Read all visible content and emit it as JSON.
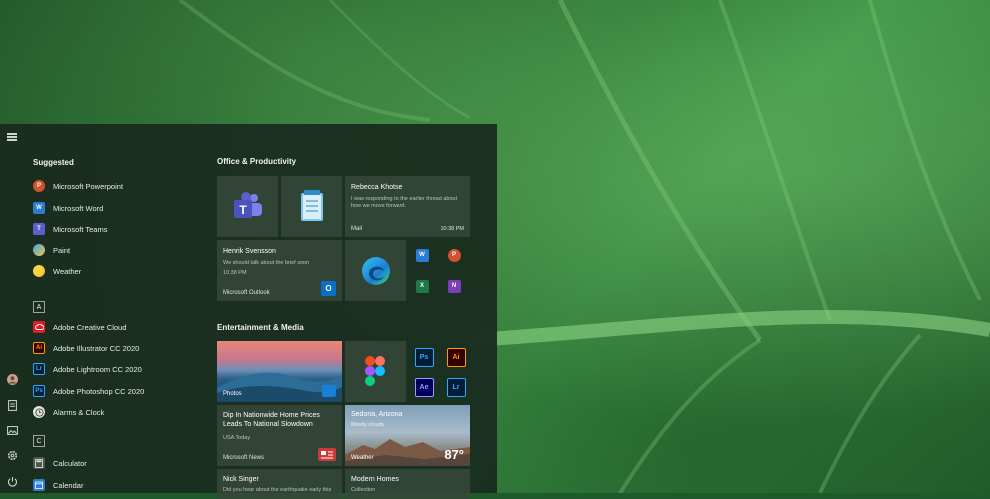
{
  "colors": {
    "accent_teams": "#5b5fc7",
    "accent_word": "#2b7cd3",
    "accent_excel": "#1e7a45",
    "accent_powerpoint": "#d35230",
    "accent_onenote": "#7b3fb5",
    "accent_outlook": "#0a6fc8",
    "accent_news": "#c93a3a",
    "photoshop_blue": "#31a8ff",
    "illustrator_orange": "#ff9a00",
    "aftereffects_purple": "#9999ff",
    "lightroom_blue": "#31a8ff"
  },
  "rail_icons": [
    "hamburger-icon",
    "user-avatar-icon",
    "document-icon",
    "pictures-icon",
    "settings-icon",
    "power-icon"
  ],
  "suggested": {
    "title": "Suggested",
    "items": [
      {
        "label": "Microsoft Powerpoint",
        "icon": "powerpoint-icon"
      },
      {
        "label": "Microsoft Word",
        "icon": "word-icon"
      },
      {
        "label": "Microsoft Teams",
        "icon": "teams-icon"
      },
      {
        "label": "Paint",
        "icon": "paint-icon"
      },
      {
        "label": "Weather",
        "icon": "weather-icon"
      }
    ]
  },
  "section_a": {
    "letter": "A",
    "items": [
      {
        "label": "Adobe Creative Cloud",
        "icon": "creative-cloud-icon"
      },
      {
        "label": "Adobe Illustrator CC 2020",
        "icon": "illustrator-icon",
        "abbr": "Ai"
      },
      {
        "label": "Adobe Lightroom CC 2020",
        "icon": "lightroom-icon",
        "abbr": "Lr"
      },
      {
        "label": "Adobe Photoshop CC 2020",
        "icon": "photoshop-icon",
        "abbr": "Ps"
      },
      {
        "label": "Alarms & Clock",
        "icon": "clock-icon"
      }
    ]
  },
  "section_c": {
    "letter": "C",
    "items": [
      {
        "label": "Calculator",
        "icon": "calculator-icon"
      },
      {
        "label": "Calendar",
        "icon": "calendar-icon"
      }
    ]
  },
  "office_group": {
    "title": "Office & Productivity",
    "mail_tile": {
      "sender": "Rebecca Khotse",
      "preview": "I was responding to the earlier thread about how we move forward.",
      "app": "Mail",
      "time": "10:38 PM"
    },
    "outlook_tile": {
      "sender": "Henrik Svensson",
      "preview": "We should talk about the brief soon",
      "time": "10:38 PM",
      "app": "Microsoft Outlook"
    },
    "mini_labels": {
      "word": "W",
      "powerpoint": "P",
      "excel": "X",
      "onenote": "N"
    }
  },
  "media_group": {
    "title": "Entertainment & Media",
    "photos_tile": {
      "app": "Photos"
    },
    "adobe": {
      "ps": "Ps",
      "ai": "Ai",
      "ae": "Ae",
      "lr": "Lr"
    },
    "news_tile": {
      "headline": "Dip In Nationwide Home Prices Leads To National Slowdown",
      "source": "USA Today",
      "app": "Microsoft News"
    },
    "weather_tile": {
      "city": "Sedona, Arizona",
      "condition": "Mostly cloudy",
      "app": "Weather",
      "temp": "87°"
    },
    "nick_tile": {
      "sender": "Nick Singer",
      "preview": "Did you hear about the earthquake early this"
    },
    "homes_tile": {
      "title": "Modern Homes",
      "subtitle": "Collection"
    }
  }
}
